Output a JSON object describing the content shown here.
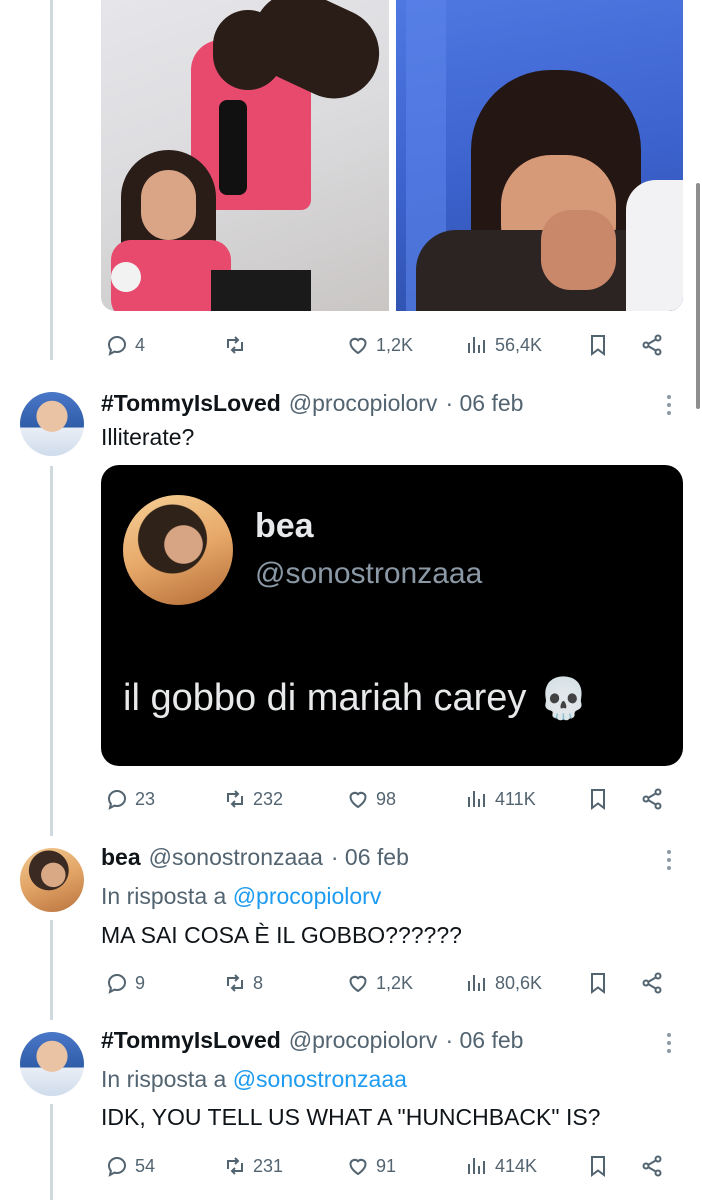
{
  "tweet0": {
    "stats": {
      "replies": "4",
      "reposts": "",
      "likes": "1,2K",
      "views": "56,4K"
    }
  },
  "tweet1": {
    "name": "#TommyIsLoved",
    "handle": "@procopiolorv",
    "date": "· 06 feb",
    "text": "Illiterate?",
    "embed": {
      "name": "bea",
      "handle": "@sonostronzaaa",
      "text": "il gobbo di mariah carey",
      "emoji": "💀"
    },
    "stats": {
      "replies": "23",
      "reposts": "232",
      "likes": "98",
      "views": "411K"
    }
  },
  "tweet2": {
    "name": "bea",
    "handle": "@sonostronzaaa",
    "date": "· 06 feb",
    "reply_prefix": "In risposta a",
    "reply_to": "@procopiolorv",
    "text": "MA SAI COSA È IL GOBBO??????",
    "stats": {
      "replies": "9",
      "reposts": "8",
      "likes": "1,2K",
      "views": "80,6K"
    }
  },
  "tweet3": {
    "name": "#TommyIsLoved",
    "handle": "@procopiolorv",
    "date": "· 06 feb",
    "reply_prefix": "In risposta a",
    "reply_to": "@sonostronzaaa",
    "text": "IDK, YOU TELL US WHAT A \"HUNCHBACK\" IS?",
    "stats": {
      "replies": "54",
      "reposts": "231",
      "likes": "91",
      "views": "414K"
    }
  },
  "icons": [
    "reply-icon",
    "repost-icon",
    "like-icon",
    "views-icon",
    "bookmark-icon",
    "share-icon",
    "more-icon"
  ],
  "colors": {
    "text": "#0f1419",
    "secondary": "#536471",
    "link": "#1d9bf0",
    "thread": "#cfd9de"
  }
}
